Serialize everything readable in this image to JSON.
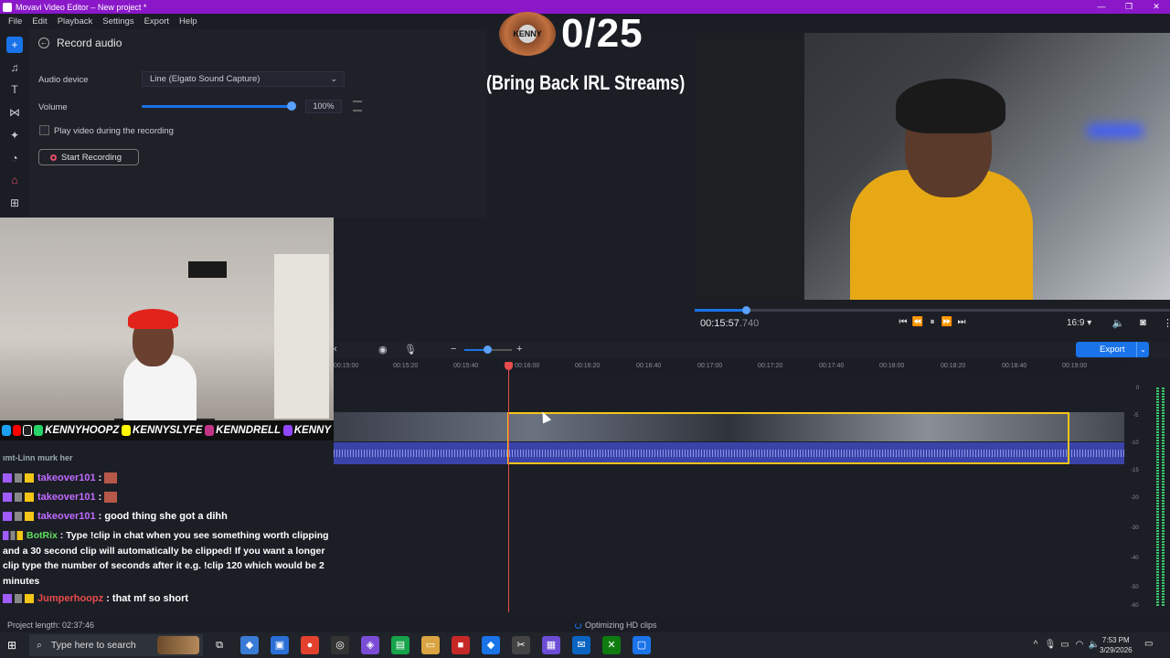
{
  "window": {
    "title": "Movavi Video Editor – New project *",
    "min": "—",
    "max": "❐",
    "close": "✕"
  },
  "menu": [
    "File",
    "Edit",
    "Playback",
    "Settings",
    "Export",
    "Help"
  ],
  "tools": [
    "plus-icon",
    "music-icon",
    "text-icon",
    "transition-icon",
    "magic-icon",
    "clock-icon",
    "record-icon",
    "grid-icon"
  ],
  "record_panel": {
    "title": "Record audio",
    "audio_device_label": "Audio device",
    "audio_device_value": "Line (Elgato Sound Capture)",
    "volume_label": "Volume",
    "volume_value": "100%",
    "volume_level": 1.0,
    "play_video_label": "Play video during the recording",
    "start_button": "Start Recording"
  },
  "overlay": {
    "counter": "0/25",
    "subtitle": "(Bring Back IRL Streams)",
    "logo_text": "KENNY"
  },
  "player": {
    "timecode": "00:15:57",
    "timecode_ms": ".740",
    "progress": 0.108,
    "aspect": "16:9 ▾",
    "controls": [
      "⏮",
      "⏪",
      "⏸",
      "⏩",
      "⏭"
    ]
  },
  "socials": [
    {
      "handle": "KENNYHOOPZ",
      "color": "#e84c4c"
    },
    {
      "handle": "KENNYSLYFE",
      "color": "#f3e317"
    },
    {
      "handle": "KENNDRELL",
      "color": "#c06bff"
    },
    {
      "handle": "KENNY",
      "color": "#9146ff"
    }
  ],
  "timeline": {
    "ruler": [
      "00:15:00",
      "00:15:20",
      "00:15:40",
      "00:16:00",
      "00:16:20",
      "00:16:40",
      "00:17:00",
      "00:17:20",
      "00:17:40",
      "00:18:00",
      "00:18:20",
      "00:18:40",
      "00:19:00"
    ],
    "export_label": "Export",
    "meter_labels": [
      "0",
      "-5",
      "-10",
      "-15",
      "-20",
      "-30",
      "-40",
      "-50",
      "-60"
    ]
  },
  "chat": [
    {
      "user": "takeover101",
      "text": " :",
      "color": "purple",
      "emote": true
    },
    {
      "user": "takeover101",
      "text": " :",
      "color": "purple",
      "emote": true
    },
    {
      "user": "takeover101",
      "text": " : good thing she got a dihh",
      "color": "purple",
      "emote": false
    }
  ],
  "chat_bot": {
    "user": "BotRix",
    "text": " : Type !clip in chat when you see something worth clipping and a 30 second clip will automatically be clipped! If you want a longer clip type the number of seconds after it e.g. !clip 120 which would be 2 minutes"
  },
  "chat_last": {
    "user": "Jumperhoopz",
    "text": " : that mf so short"
  },
  "chat_top_partial": "ımt-Linn murk her",
  "status": {
    "project_length": "Project length: 02:37:46",
    "optimizing": "Optimizing HD clips"
  },
  "taskbar": {
    "search_placeholder": "Type here to search",
    "time": "7:53 PM",
    "date": "3/29/2026"
  }
}
